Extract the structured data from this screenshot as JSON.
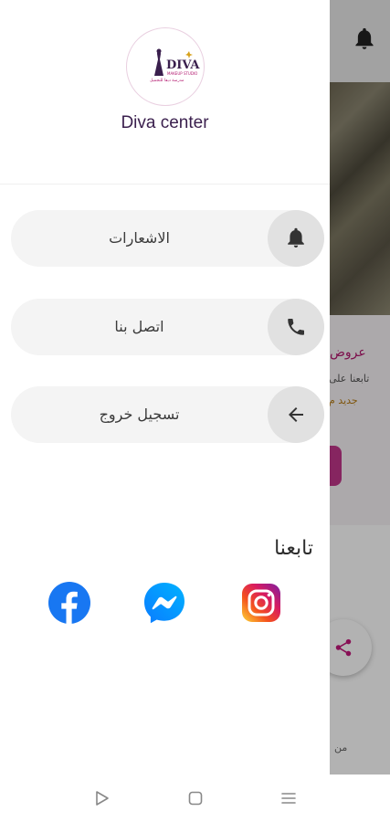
{
  "background": {
    "card_title": "عروض",
    "card_text_1": "تابعنا على",
    "card_text_2": "جديد م",
    "bottom_text": "من"
  },
  "drawer": {
    "brand_name": "Diva center",
    "logo": {
      "line1": "DIVA",
      "line2": "MAKEUP STUDIO",
      "line3": "مدرسة ديفا للتجميل"
    },
    "menu": [
      {
        "label": "الاشعارات",
        "icon": "bell-icon"
      },
      {
        "label": "اتصل بنا",
        "icon": "phone-icon"
      },
      {
        "label": "تسجيل خروج",
        "icon": "arrow-left-icon"
      }
    ],
    "follow_title": "تابعنا",
    "socials": [
      "facebook-icon",
      "messenger-icon",
      "instagram-icon"
    ]
  },
  "colors": {
    "brand": "#3a1f4d",
    "accent": "#b2156d",
    "menu_bg": "#f4f4f4",
    "icon_circle": "#e1e1e1"
  }
}
